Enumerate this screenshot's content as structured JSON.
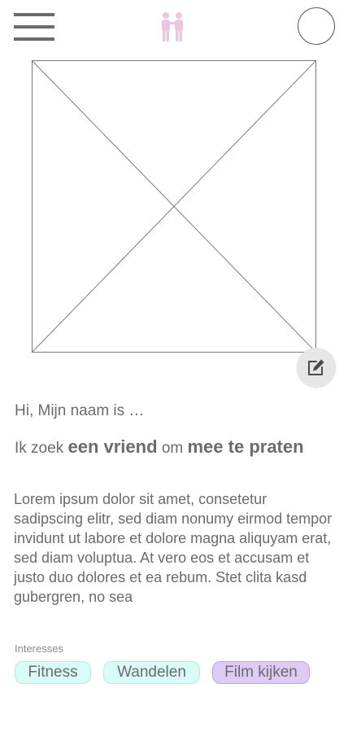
{
  "header": {
    "menu_icon": "hamburger-menu-icon",
    "logo_icon": "couple-logo-icon",
    "logo_color": "#e7c8dc",
    "avatar_icon": "profile-avatar-circle"
  },
  "profile": {
    "photo_icon": "image-placeholder-icon",
    "edit_icon": "edit-pencil-icon",
    "greeting": "Hi, Mijn naam is …",
    "seeking": {
      "prefix": "Ik zoek",
      "looking_for": "een vriend",
      "connector": "om",
      "purpose": "mee te praten"
    },
    "bio": "Lorem ipsum dolor sit amet, consetetur sadipscing elitr, sed diam nonumy eirmod tempor invidunt ut labore et dolore magna aliquyam erat, sed diam voluptua. At vero eos et accusam et justo duo dolores et ea rebum. Stet clita kasd gubergren, no sea"
  },
  "interests": {
    "label": "Interesses",
    "items": [
      {
        "label": "Fitness",
        "color": "#d9fbf5"
      },
      {
        "label": "Wandelen",
        "color": "#d9fbf5"
      },
      {
        "label": "Film kijken",
        "color": "#dcccf5"
      }
    ]
  }
}
